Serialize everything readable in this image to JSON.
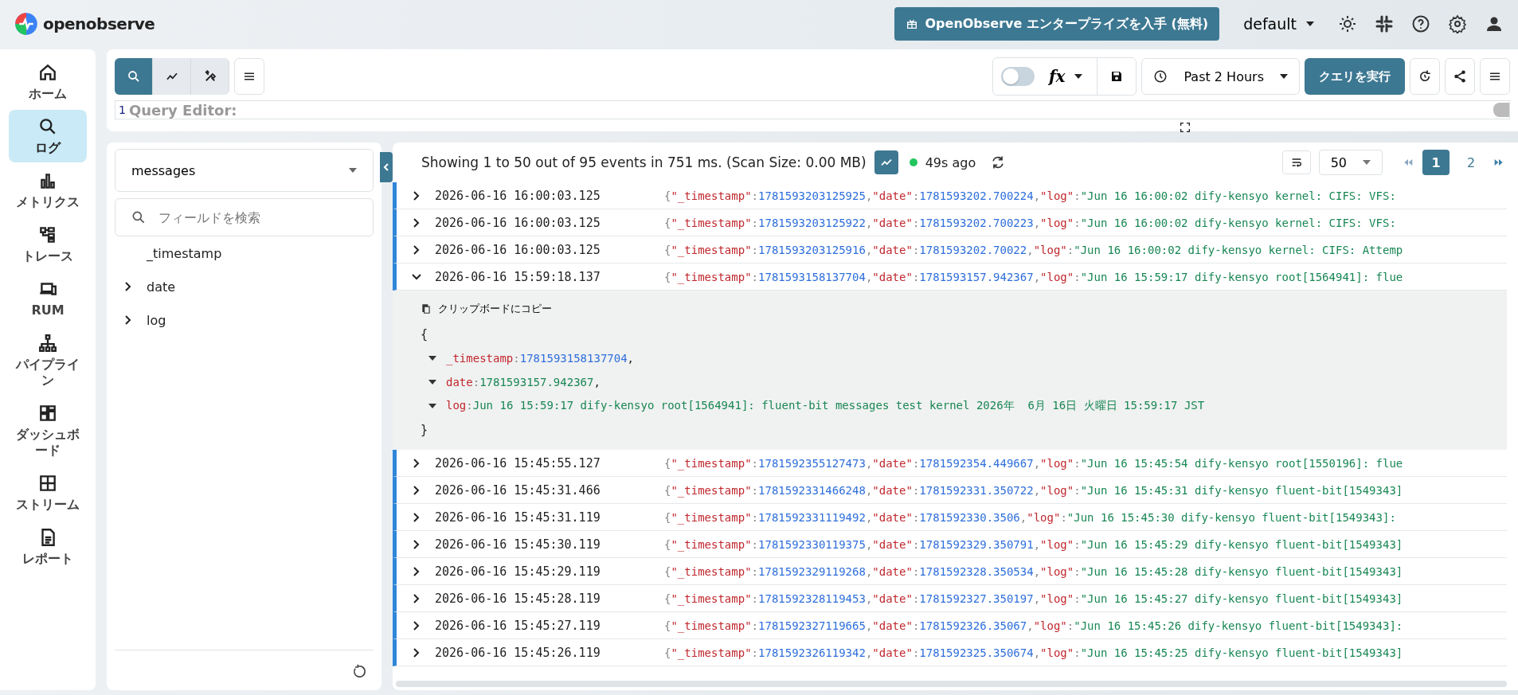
{
  "header": {
    "logo_text": "openobserve",
    "enterprise_button": "OpenObserve エンタープライズを入手 (無料)",
    "org": "default"
  },
  "nav": [
    {
      "label": "ホーム",
      "kind": "home",
      "selected": false
    },
    {
      "label": "ログ",
      "kind": "search",
      "selected": true
    },
    {
      "label": "メトリクス",
      "kind": "bars",
      "selected": false
    },
    {
      "label": "トレース",
      "kind": "trace",
      "selected": false
    },
    {
      "label": "RUM",
      "kind": "devices",
      "selected": false
    },
    {
      "label": "パイプライン",
      "kind": "pipeline",
      "selected": false
    },
    {
      "label": "ダッシュボード",
      "kind": "dashboard",
      "selected": false
    },
    {
      "label": "ストリーム",
      "kind": "grid",
      "selected": false
    },
    {
      "label": "レポート",
      "kind": "report",
      "selected": false
    }
  ],
  "toolbar": {
    "modes": [
      {
        "kind": "search",
        "selected": true
      },
      {
        "kind": "chart",
        "selected": false
      },
      {
        "kind": "tools",
        "selected": false
      }
    ],
    "sql_toggle": {
      "on": false
    },
    "fx_label": "fx",
    "time_range": "Past 2 Hours",
    "run_button": "クエリを実行"
  },
  "query_editor": {
    "line_number": "1",
    "placeholder": "Query Editor:"
  },
  "fields_panel": {
    "stream": "messages",
    "search_placeholder": "フィールドを検索",
    "fields": [
      {
        "name": "_timestamp",
        "expandable": false
      },
      {
        "name": "date",
        "expandable": true
      },
      {
        "name": "log",
        "expandable": true
      }
    ]
  },
  "results": {
    "summary": "Showing 1 to 50 out of 95 events in 751 ms. (Scan Size: 0.00 MB)",
    "histogram": {
      "on": true
    },
    "last_refresh": "49s ago",
    "page_size": "50",
    "pages": [
      {
        "label": "1",
        "selected": true
      },
      {
        "label": "2",
        "selected": false
      }
    ],
    "rows": [
      {
        "time": "2026-06-16 16:00:03.125",
        "expanded": false,
        "fields": [
          {
            "lead": "{",
            "key": "\"_timestamp\"",
            "sep": ":",
            "value": "1781593203125925",
            "kind": "number"
          },
          {
            "lead": ",",
            "key": "\"date\"",
            "sep": ":",
            "value": "1781593202.700224",
            "kind": "number"
          },
          {
            "lead": ",",
            "key": "\"log\"",
            "sep": ":",
            "value": "\"Jun 16 16:00:02 dify-kensyo kernel: CIFS: VFS:",
            "kind": "string"
          }
        ]
      },
      {
        "time": "2026-06-16 16:00:03.125",
        "expanded": false,
        "fields": [
          {
            "lead": "{",
            "key": "\"_timestamp\"",
            "sep": ":",
            "value": "1781593203125922",
            "kind": "number"
          },
          {
            "lead": ",",
            "key": "\"date\"",
            "sep": ":",
            "value": "1781593202.700223",
            "kind": "number"
          },
          {
            "lead": ",",
            "key": "\"log\"",
            "sep": ":",
            "value": "\"Jun 16 16:00:02 dify-kensyo kernel: CIFS: VFS:",
            "kind": "string"
          }
        ]
      },
      {
        "time": "2026-06-16 16:00:03.125",
        "expanded": false,
        "fields": [
          {
            "lead": "{",
            "key": "\"_timestamp\"",
            "sep": ":",
            "value": "1781593203125916",
            "kind": "number"
          },
          {
            "lead": ",",
            "key": "\"date\"",
            "sep": ":",
            "value": "1781593202.70022",
            "kind": "number"
          },
          {
            "lead": ",",
            "key": "\"log\"",
            "sep": ":",
            "value": "\"Jun 16 16:00:02 dify-kensyo kernel: CIFS: Attemp",
            "kind": "string"
          }
        ]
      },
      {
        "time": "2026-06-16 15:59:18.137",
        "expanded": true,
        "fields": [
          {
            "lead": "{",
            "key": "\"_timestamp\"",
            "sep": ":",
            "value": "1781593158137704",
            "kind": "number"
          },
          {
            "lead": ",",
            "key": "\"date\"",
            "sep": ":",
            "value": "1781593157.942367",
            "kind": "number"
          },
          {
            "lead": ",",
            "key": "\"log\"",
            "sep": ":",
            "value": "\"Jun 16 15:59:17 dify-kensyo root[1564941]: flue",
            "kind": "string"
          }
        ],
        "detail": {
          "copy_label": "クリップボードにコピー",
          "open": "{",
          "close": "}",
          "fields": [
            {
              "key": "_timestamp",
              "sep": ":",
              "value": "1781593158137704",
              "trail": ",",
              "color": "#2f6fdb"
            },
            {
              "key": "date",
              "sep": ":",
              "value": "1781593157.942367",
              "trail": ",",
              "color": "#198754"
            },
            {
              "key": "log",
              "sep": ":",
              "value": "Jun 16 15:59:17 dify-kensyo root[1564941]: fluent-bit messages test kernel 2026年  6月 16日 火曜日 15:59:17 JST",
              "color": "#198754"
            }
          ]
        }
      },
      {
        "time": "2026-06-16 15:45:55.127",
        "expanded": false,
        "fields": [
          {
            "lead": "{",
            "key": "\"_timestamp\"",
            "sep": ":",
            "value": "1781592355127473",
            "kind": "number"
          },
          {
            "lead": ",",
            "key": "\"date\"",
            "sep": ":",
            "value": "1781592354.449667",
            "kind": "number"
          },
          {
            "lead": ",",
            "key": "\"log\"",
            "sep": ":",
            "value": "\"Jun 16 15:45:54 dify-kensyo root[1550196]: flue",
            "kind": "string"
          }
        ]
      },
      {
        "time": "2026-06-16 15:45:31.466",
        "expanded": false,
        "fields": [
          {
            "lead": "{",
            "key": "\"_timestamp\"",
            "sep": ":",
            "value": "1781592331466248",
            "kind": "number"
          },
          {
            "lead": ",",
            "key": "\"date\"",
            "sep": ":",
            "value": "1781592331.350722",
            "kind": "number"
          },
          {
            "lead": ",",
            "key": "\"log\"",
            "sep": ":",
            "value": "\"Jun 16 15:45:31 dify-kensyo fluent-bit[1549343]",
            "kind": "string"
          }
        ]
      },
      {
        "time": "2026-06-16 15:45:31.119",
        "expanded": false,
        "fields": [
          {
            "lead": "{",
            "key": "\"_timestamp\"",
            "sep": ":",
            "value": "1781592331119492",
            "kind": "number"
          },
          {
            "lead": ",",
            "key": "\"date\"",
            "sep": ":",
            "value": "1781592330.3506",
            "kind": "number"
          },
          {
            "lead": ",",
            "key": "\"log\"",
            "sep": ":",
            "value": "\"Jun 16 15:45:30 dify-kensyo fluent-bit[1549343]:",
            "kind": "string"
          }
        ]
      },
      {
        "time": "2026-06-16 15:45:30.119",
        "expanded": false,
        "fields": [
          {
            "lead": "{",
            "key": "\"_timestamp\"",
            "sep": ":",
            "value": "1781592330119375",
            "kind": "number"
          },
          {
            "lead": ",",
            "key": "\"date\"",
            "sep": ":",
            "value": "1781592329.350791",
            "kind": "number"
          },
          {
            "lead": ",",
            "key": "\"log\"",
            "sep": ":",
            "value": "\"Jun 16 15:45:29 dify-kensyo fluent-bit[1549343]",
            "kind": "string"
          }
        ]
      },
      {
        "time": "2026-06-16 15:45:29.119",
        "expanded": false,
        "fields": [
          {
            "lead": "{",
            "key": "\"_timestamp\"",
            "sep": ":",
            "value": "1781592329119268",
            "kind": "number"
          },
          {
            "lead": ",",
            "key": "\"date\"",
            "sep": ":",
            "value": "1781592328.350534",
            "kind": "number"
          },
          {
            "lead": ",",
            "key": "\"log\"",
            "sep": ":",
            "value": "\"Jun 16 15:45:28 dify-kensyo fluent-bit[1549343]",
            "kind": "string"
          }
        ]
      },
      {
        "time": "2026-06-16 15:45:28.119",
        "expanded": false,
        "fields": [
          {
            "lead": "{",
            "key": "\"_timestamp\"",
            "sep": ":",
            "value": "1781592328119453",
            "kind": "number"
          },
          {
            "lead": ",",
            "key": "\"date\"",
            "sep": ":",
            "value": "1781592327.350197",
            "kind": "number"
          },
          {
            "lead": ",",
            "key": "\"log\"",
            "sep": ":",
            "value": "\"Jun 16 15:45:27 dify-kensyo fluent-bit[1549343]",
            "kind": "string"
          }
        ]
      },
      {
        "time": "2026-06-16 15:45:27.119",
        "expanded": false,
        "fields": [
          {
            "lead": "{",
            "key": "\"_timestamp\"",
            "sep": ":",
            "value": "1781592327119665",
            "kind": "number"
          },
          {
            "lead": ",",
            "key": "\"date\"",
            "sep": ":",
            "value": "1781592326.35067",
            "kind": "number"
          },
          {
            "lead": ",",
            "key": "\"log\"",
            "sep": ":",
            "value": "\"Jun 16 15:45:26 dify-kensyo fluent-bit[1549343]:",
            "kind": "string"
          }
        ]
      },
      {
        "time": "2026-06-16 15:45:26.119",
        "expanded": false,
        "fields": [
          {
            "lead": "{",
            "key": "\"_timestamp\"",
            "sep": ":",
            "value": "1781592326119342",
            "kind": "number"
          },
          {
            "lead": ",",
            "key": "\"date\"",
            "sep": ":",
            "value": "1781592325.350674",
            "kind": "number"
          },
          {
            "lead": ",",
            "key": "\"log\"",
            "sep": ":",
            "value": "\"Jun 16 15:45:25 dify-kensyo fluent-bit[1549343]",
            "kind": "string"
          }
        ]
      }
    ]
  }
}
